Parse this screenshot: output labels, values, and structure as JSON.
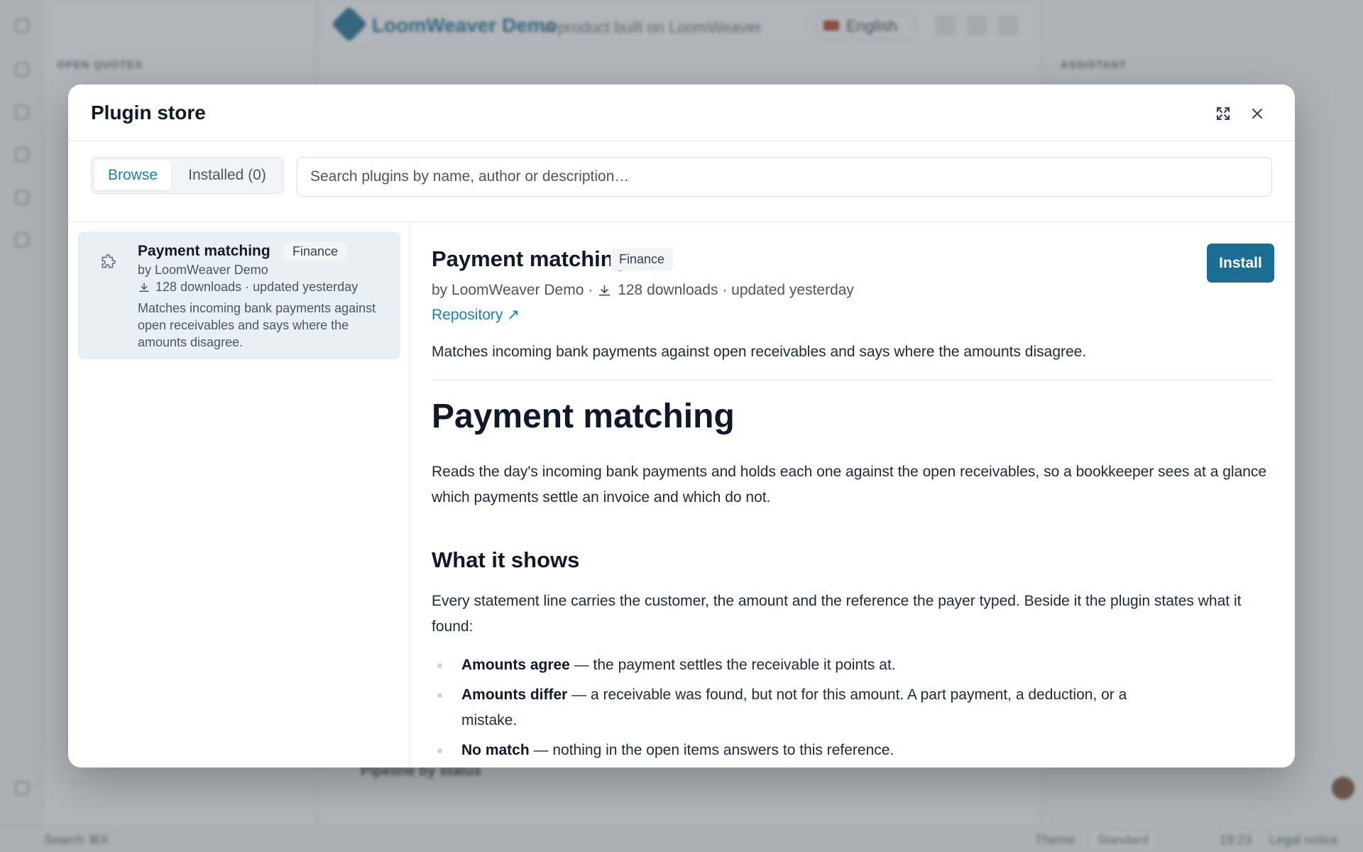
{
  "background": {
    "left_caption": "OPEN QUOTES",
    "brand_name": "LoomWeaver Demo",
    "brand_tagline": "A product built on LoomWeaver",
    "language": "English",
    "right_caption": "ASSISTANT",
    "section_label": "Pipeline by status",
    "footer": {
      "search": "Search ⌘K",
      "theme_label": "Theme",
      "theme_value": "Standard",
      "time": "19:23",
      "status": "Legal notice"
    }
  },
  "modal": {
    "title": "Plugin store",
    "icons": {
      "expand": "expand-icon",
      "close": "close-icon"
    },
    "tabs": {
      "browse": "Browse",
      "installed": "Installed (0)"
    },
    "search_placeholder": "Search plugins by name, author or description…",
    "list": [
      {
        "icon": "puzzle-icon",
        "name": "Payment matching",
        "category": "Finance",
        "author": "by LoomWeaver Demo",
        "stats": "128 downloads · updated yesterday",
        "description": "Matches incoming bank payments against open receivables and says where the amounts disagree."
      }
    ],
    "detail": {
      "name": "Payment matching",
      "category": "Finance",
      "install_label": "Install",
      "author": "by LoomWeaver Demo ·",
      "stats": "128 downloads · updated yesterday",
      "repo_label": "Repository ↗",
      "summary": "Matches incoming bank payments against open receivables and says where the amounts disagree.",
      "readme": {
        "h1": "Payment matching",
        "intro": "Reads the day's incoming bank payments and holds each one against the open receivables, so a bookkeeper sees at a glance which payments settle an invoice and which do not.",
        "h2": "What it shows",
        "para": "Every statement line carries the customer, the amount and the reference the payer typed. Beside it the plugin states what it found:",
        "items": [
          {
            "term": "Amounts agree",
            "text": " — the payment settles the receivable it points at."
          },
          {
            "term": "Amounts differ",
            "text": " — a receivable was found, but not for this amount. A part payment, a deduction, or a mistake."
          },
          {
            "term": "No match",
            "text": " — nothing in the open items answers to this reference."
          }
        ]
      }
    }
  },
  "colors": {
    "accent": "#1b6d93",
    "link": "#1b7fb0",
    "selected_card": "#e8f0f5",
    "overlay": "rgba(86,93,102,0.46)"
  }
}
